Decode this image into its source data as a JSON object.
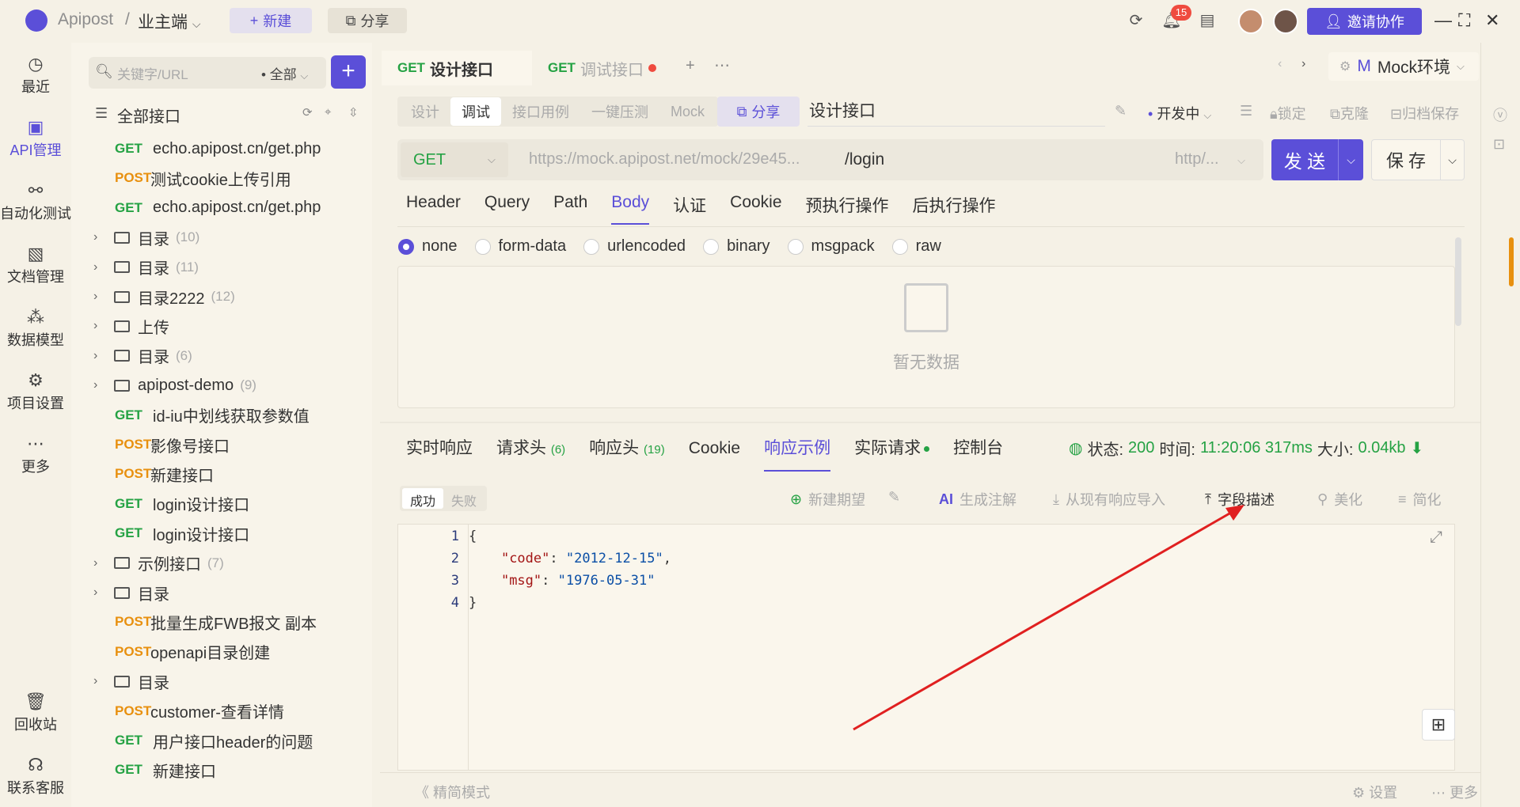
{
  "app": {
    "name": "Apipost",
    "separator": "/",
    "project": "业主端"
  },
  "topbar": {
    "new_label": "新建",
    "share_label": "分享",
    "notifications_count": "15",
    "invite_label": "邀请协作"
  },
  "nav": [
    {
      "label": "最近",
      "icon": "history-icon"
    },
    {
      "label": "API管理",
      "icon": "api-icon"
    },
    {
      "label": "自动化测试",
      "icon": "automation-icon"
    },
    {
      "label": "文档管理",
      "icon": "document-icon"
    },
    {
      "label": "数据模型",
      "icon": "data-model-icon"
    },
    {
      "label": "项目设置",
      "icon": "project-settings-icon"
    },
    {
      "label": "更多",
      "icon": "more-icon"
    },
    {
      "label": "回收站",
      "icon": "trash-icon"
    },
    {
      "label": "联系客服",
      "icon": "headset-icon"
    }
  ],
  "tree": {
    "search_placeholder": "关键字/URL",
    "filter_label": "全部",
    "root_label": "全部接口",
    "items": [
      {
        "type": "api",
        "method": "GET",
        "name": "echo.apipost.cn/get.php"
      },
      {
        "type": "api",
        "method": "POST",
        "name": "测试cookie上传引用"
      },
      {
        "type": "api",
        "method": "GET",
        "name": "echo.apipost.cn/get.php"
      },
      {
        "type": "folder",
        "name": "目录",
        "count": "(10)"
      },
      {
        "type": "folder",
        "name": "目录",
        "count": "(11)"
      },
      {
        "type": "folder",
        "name": "目录2222",
        "count": "(12)"
      },
      {
        "type": "folder",
        "name": "上传",
        "count": ""
      },
      {
        "type": "folder",
        "name": "目录",
        "count": "(6)"
      },
      {
        "type": "folder",
        "name": "apipost-demo",
        "count": "(9)"
      },
      {
        "type": "api",
        "method": "GET",
        "name": "id-iu中划线获取参数值"
      },
      {
        "type": "api",
        "method": "POST",
        "name": "影像号接口"
      },
      {
        "type": "api",
        "method": "POST",
        "name": "新建接口"
      },
      {
        "type": "api",
        "method": "GET",
        "name": "login设计接口"
      },
      {
        "type": "api",
        "method": "GET",
        "name": "login设计接口"
      },
      {
        "type": "folder",
        "name": "示例接口",
        "count": "(7)"
      },
      {
        "type": "folder",
        "name": "目录",
        "count": ""
      },
      {
        "type": "api",
        "method": "POST",
        "name": "批量生成FWB报文 副本"
      },
      {
        "type": "api",
        "method": "POST",
        "name": "openapi目录创建"
      },
      {
        "type": "folder",
        "name": "目录",
        "count": ""
      },
      {
        "type": "api",
        "method": "POST",
        "name": "customer-查看详情"
      },
      {
        "type": "api",
        "method": "GET",
        "name": "用户接口header的问题"
      },
      {
        "type": "api",
        "method": "GET",
        "name": "新建接口"
      }
    ]
  },
  "tabs": [
    {
      "method": "GET",
      "label": "设计接口",
      "active": true
    },
    {
      "method": "GET",
      "label": "调试接口",
      "active": false
    }
  ],
  "env": {
    "prefix": "M",
    "label": "Mock环境"
  },
  "mode_tabs": [
    "设计",
    "调试",
    "接口用例",
    "一键压测",
    "Mock"
  ],
  "share_label": "分享",
  "interface_name": "设计接口",
  "status_label": "开发中",
  "tools": {
    "lock": "锁定",
    "clone": "克隆",
    "archive": "归档保存"
  },
  "request": {
    "method": "GET",
    "base_url": "https://mock.apipost.net/mock/29e45...",
    "path": "/login",
    "protocol": "http/...",
    "send_label": "发 送",
    "save_label": "保 存"
  },
  "req_tabs": [
    "Header",
    "Query",
    "Path",
    "Body",
    "认证",
    "Cookie",
    "预执行操作",
    "后执行操作"
  ],
  "body_types": [
    "none",
    "form-data",
    "urlencoded",
    "binary",
    "msgpack",
    "raw"
  ],
  "empty_text": "暂无数据",
  "resp_tabs": [
    {
      "label": "实时响应",
      "count": ""
    },
    {
      "label": "请求头",
      "count": "(6)"
    },
    {
      "label": "响应头",
      "count": "(19)"
    },
    {
      "label": "Cookie",
      "count": ""
    },
    {
      "label": "响应示例",
      "count": ""
    },
    {
      "label": "实际请求",
      "count": ""
    },
    {
      "label": "控制台",
      "count": ""
    }
  ],
  "status": {
    "state_label": "状态:",
    "state_value": "200",
    "time_label": "时间:",
    "time_value": "11:20:06 317ms",
    "size_label": "大小:",
    "size_value": "0.04kb"
  },
  "example_tabs": [
    "成功",
    "失败"
  ],
  "example_tools": {
    "new_expect": "新建期望",
    "ai_annotate": "生成注解",
    "import": "从现有响应导入",
    "field_desc": "字段描述",
    "beautify": "美化",
    "simplify": "简化"
  },
  "code_lines": [
    "1",
    "2",
    "3",
    "4"
  ],
  "code": {
    "open": "{",
    "k1": "\"code\"",
    "v1": "\"2012-12-15\"",
    "k2": "\"msg\"",
    "v2": "\"1976-05-31\"",
    "close": "}"
  },
  "footer": {
    "simple_mode": "精简模式",
    "settings": "设置",
    "more": "更多"
  },
  "colors": {
    "accent": "#5b4fd8",
    "get": "#25a244",
    "post": "#e8900f",
    "arrow": "#e02020"
  }
}
